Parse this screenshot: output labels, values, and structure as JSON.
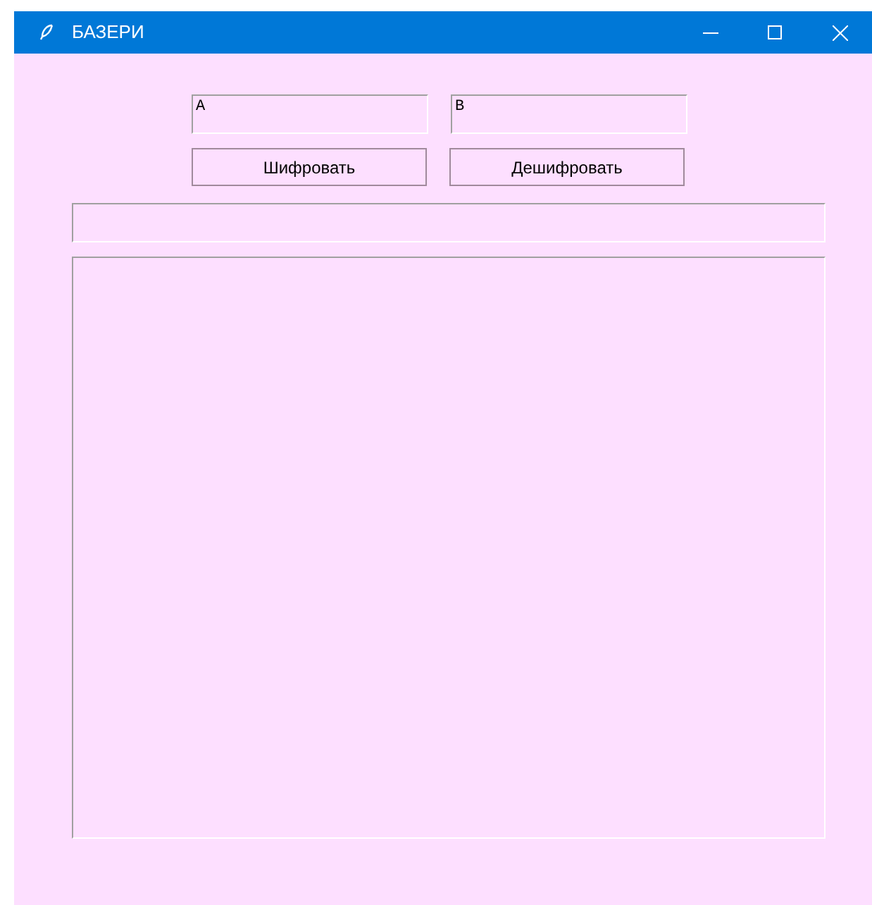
{
  "window": {
    "title": "БАЗЕРИ"
  },
  "fields": [
    {
      "value": "A"
    },
    {
      "value": "B"
    }
  ],
  "buttons": [
    "Шифровать",
    "Дешифровать"
  ]
}
